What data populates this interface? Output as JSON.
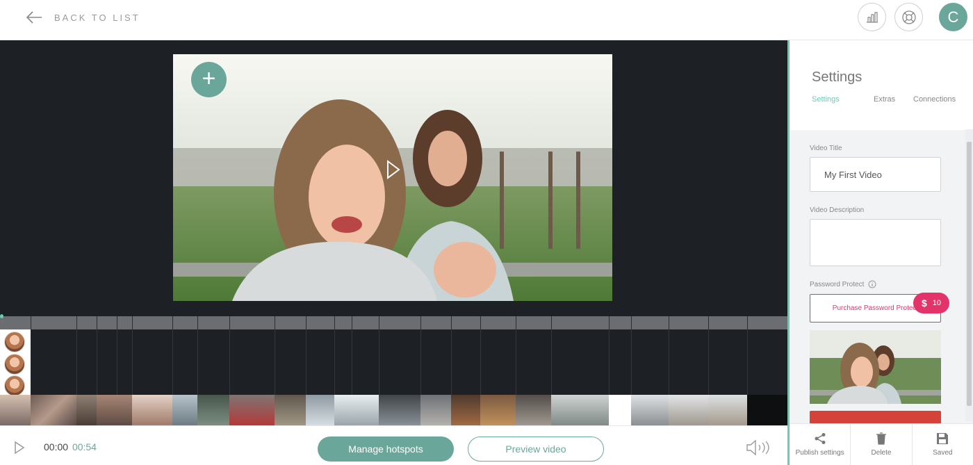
{
  "header": {
    "back_label": "BACK TO LIST",
    "avatar_initial": "C"
  },
  "editor": {
    "current_time": "00:00",
    "duration": "00:54",
    "manage_label": "Manage hotspots",
    "preview_label": "Preview video"
  },
  "settings": {
    "title": "Settings",
    "tabs": [
      "Settings",
      "Extras",
      "Connections"
    ],
    "active_tab": "Settings",
    "video_title_label": "Video Title",
    "video_title_value": "My First Video",
    "video_description_label": "Video Description",
    "video_description_value": "",
    "password_label": "Password Protect",
    "purchase_label": "Purchase Password Protect",
    "price_symbol": "$",
    "price_value": "10"
  },
  "footer_actions": [
    {
      "label": "Publish settings",
      "icon": "share-icon"
    },
    {
      "label": "Delete",
      "icon": "trash-icon"
    },
    {
      "label": "Saved",
      "icon": "save-icon"
    }
  ],
  "colors": {
    "accent": "#6aa79a",
    "accent_light": "#6dcbb4",
    "pink": "#e3336b",
    "dark": "#1d2024"
  }
}
